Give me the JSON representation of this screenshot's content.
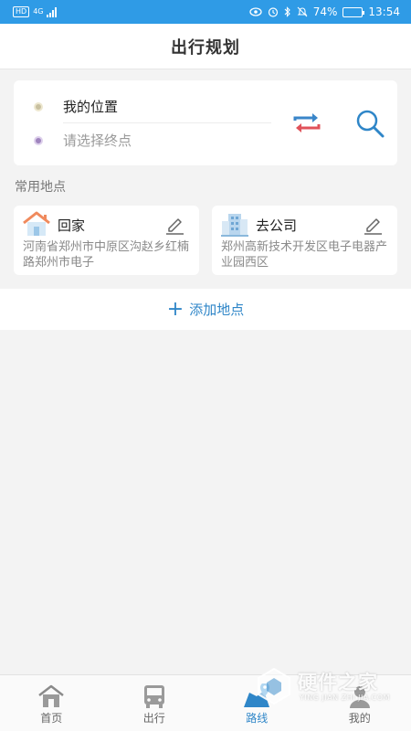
{
  "status_bar": {
    "hd": "HD",
    "network": "4G",
    "battery_text": "74%",
    "battery_level": 0.74,
    "time": "13:54",
    "icons": [
      "eye-icon",
      "alarm-icon",
      "bluetooth-icon",
      "mute-icon"
    ]
  },
  "header": {
    "title": "出行规划"
  },
  "route": {
    "start_label": "我的位置",
    "end_placeholder": "请选择终点",
    "swap_icon": "swap-arrows-icon",
    "search_icon": "search-icon"
  },
  "section": {
    "frequent_places": "常用地点"
  },
  "places": [
    {
      "name": "回家",
      "address": "河南省郑州市中原区沟赵乡红楠路郑州市电子",
      "icon": "house-icon"
    },
    {
      "name": "去公司",
      "address": "郑州高新技术开发区电子电器产业园西区",
      "icon": "office-building-icon"
    }
  ],
  "add_place": {
    "label": "添加地点"
  },
  "nav": {
    "items": [
      {
        "label": "首页",
        "icon": "home-icon"
      },
      {
        "label": "出行",
        "icon": "bus-icon"
      },
      {
        "label": "路线",
        "icon": "route-map-icon",
        "active": true
      },
      {
        "label": "我的",
        "icon": "user-icon"
      }
    ]
  },
  "watermark": {
    "text": "硬件之家",
    "sub": "YING JIAN ZHI JIA.COM"
  },
  "colors": {
    "status_bar": "#2f9be6",
    "accent": "#2f86c8",
    "swap_red": "#e0525a",
    "swap_blue": "#3a86c9"
  }
}
